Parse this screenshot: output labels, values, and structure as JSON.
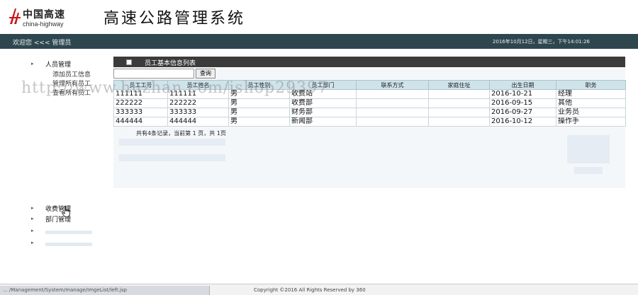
{
  "header": {
    "logo_cn": "中国高速",
    "logo_en": "china-highway",
    "system_title": "高速公路管理系统"
  },
  "topbar": {
    "welcome": "欢迎您 <<< 管理员",
    "datetime": "2016年10月12日，星期三，下午14:01:26"
  },
  "sidebar": {
    "groups": [
      {
        "title": "人员管理",
        "items": [
          "添加员工信息",
          "管理所有员工",
          "查看所有员工"
        ]
      },
      {
        "title": "收费管理",
        "items": []
      },
      {
        "title": "部门管理",
        "items": []
      }
    ]
  },
  "panel": {
    "title": "员工基本信息列表",
    "search_placeholder": "",
    "search_button": "查询"
  },
  "table": {
    "columns": [
      "员工工号",
      "员工姓名",
      "员工性别",
      "员工部门",
      "联系方式",
      "家庭住址",
      "出生日期",
      "职务"
    ],
    "rows": [
      [
        "111111",
        "111111",
        "男",
        "收费站",
        "",
        "",
        "2016-10-21",
        "经理"
      ],
      [
        "222222",
        "222222",
        "男",
        "收费部",
        "",
        "",
        "2016-09-15",
        "其他"
      ],
      [
        "333333",
        "333333",
        "男",
        "财务部",
        "",
        "",
        "2016-09-27",
        "业务员"
      ],
      [
        "444444",
        "444444",
        "男",
        "新闻部",
        "",
        "",
        "2016-10-12",
        "操作手"
      ]
    ]
  },
  "pager": {
    "text": "共有4条记录，当前第 1 页，共 1页"
  },
  "footer": {
    "status_url": "... /Management/System/manage/ImgeList/left.jsp",
    "copyright": "Copyright ©2016 All Rights Reserved by 360"
  },
  "watermark": "http://www.huzhan.com/ishop29397",
  "colors": {
    "topbar": "#2e474f",
    "panel_header": "#3b3b3b",
    "table_header": "#cfe3ea"
  }
}
